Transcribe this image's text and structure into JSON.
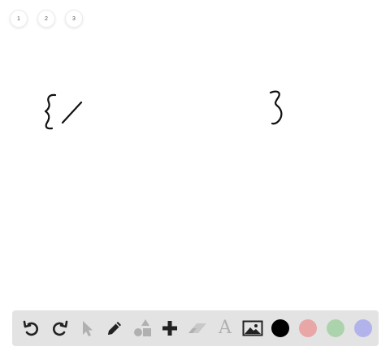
{
  "pages": [
    {
      "label": "1"
    },
    {
      "label": "2"
    },
    {
      "label": "3"
    }
  ],
  "toolbar": {
    "tools": [
      {
        "name": "undo",
        "icon": "undo-icon",
        "enabled": true
      },
      {
        "name": "redo",
        "icon": "redo-icon",
        "enabled": true
      },
      {
        "name": "select",
        "icon": "pointer-icon",
        "enabled": false
      },
      {
        "name": "pen",
        "icon": "pencil-icon",
        "enabled": true
      },
      {
        "name": "shapes",
        "icon": "shapes-icon",
        "enabled": false
      },
      {
        "name": "add",
        "icon": "plus-icon",
        "enabled": true
      },
      {
        "name": "eraser",
        "icon": "eraser-icon",
        "enabled": false
      },
      {
        "name": "text",
        "icon": "text-icon",
        "label": "A",
        "enabled": false
      },
      {
        "name": "image",
        "icon": "image-icon",
        "enabled": true
      }
    ],
    "colors": [
      {
        "name": "black",
        "hex": "#000000",
        "selected": true
      },
      {
        "name": "red",
        "hex": "#e8a6a6"
      },
      {
        "name": "green",
        "hex": "#acd4ac"
      },
      {
        "name": "blue",
        "hex": "#b3b3ec"
      }
    ]
  },
  "colors": {
    "active_icon": "#222222",
    "disabled_icon": "#b0b0b0",
    "toolbar_bg": "#e3e3e3",
    "ink": "#111111"
  }
}
